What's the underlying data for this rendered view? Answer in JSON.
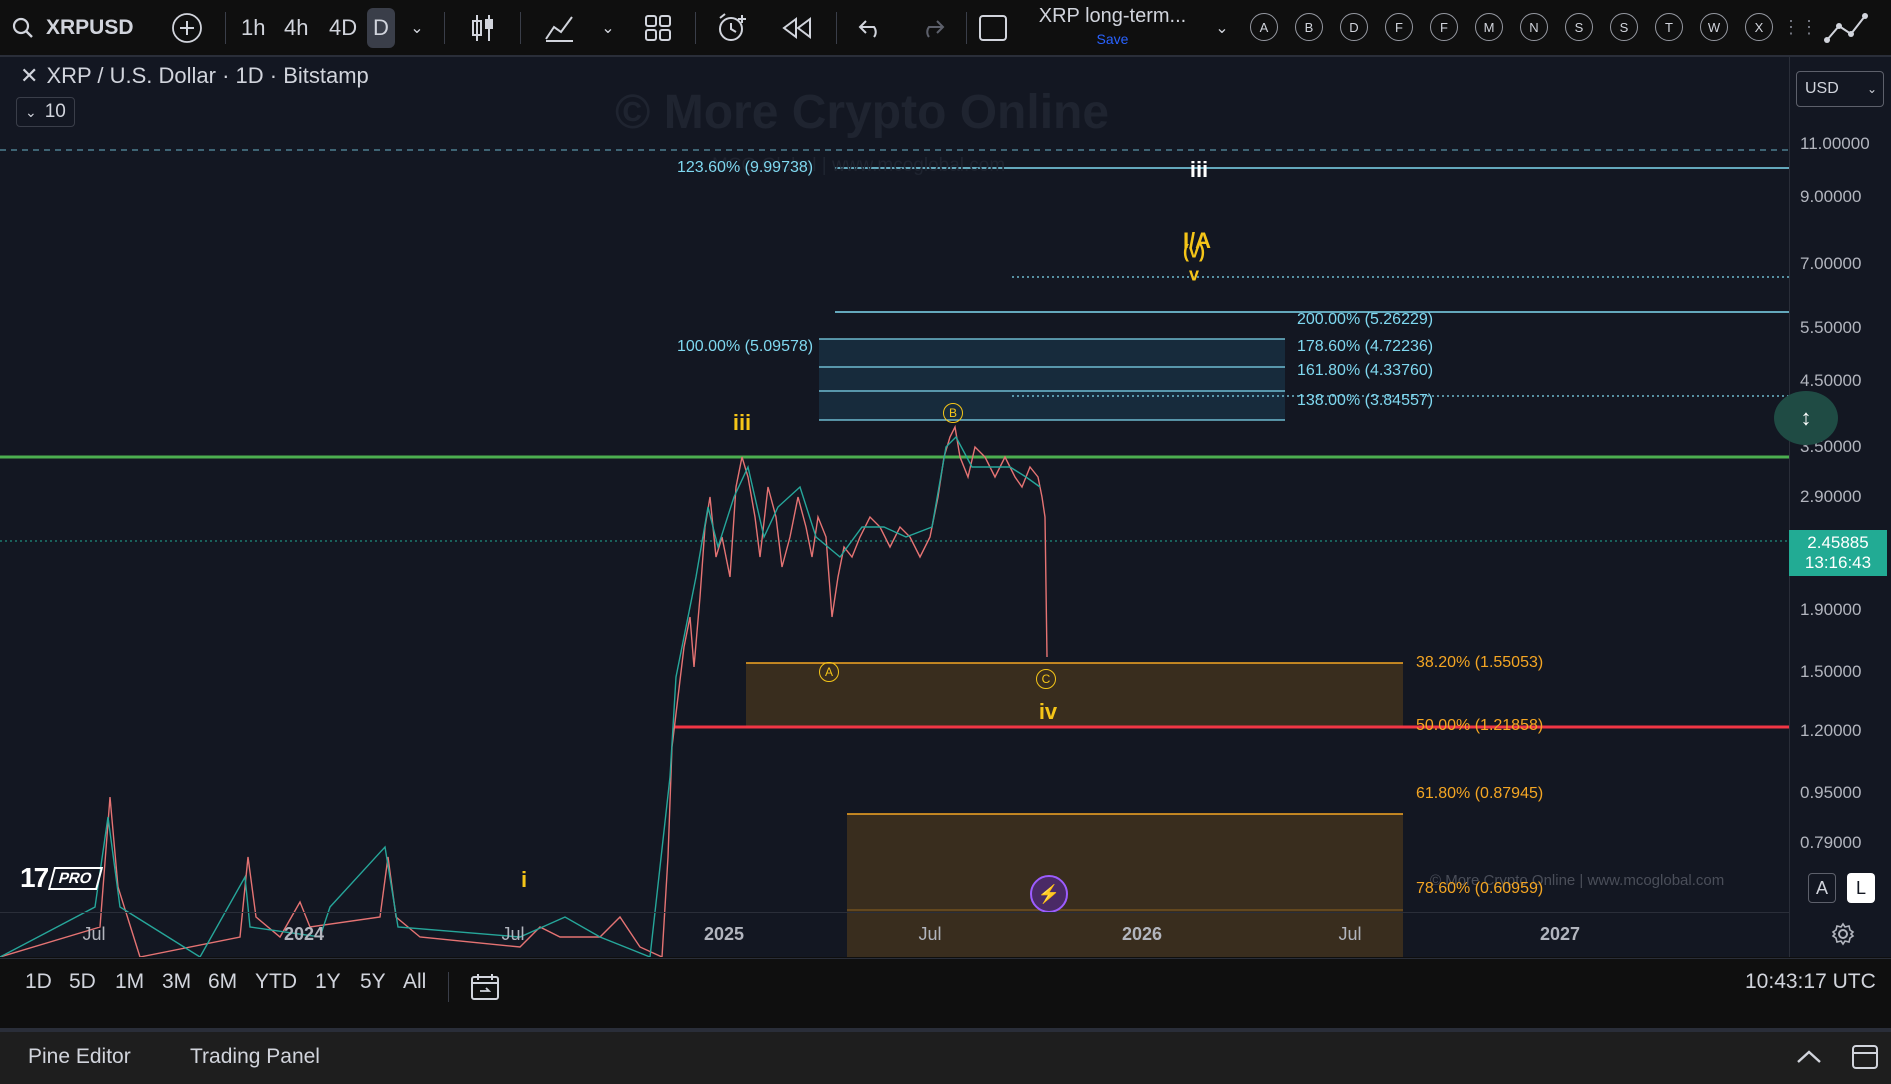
{
  "toolbar": {
    "symbol": "XRPUSD",
    "intervals": [
      "1h",
      "4h",
      "4D",
      "D"
    ],
    "layout_name": "XRP long-term...",
    "save_label": "Save",
    "letter_buttons": [
      "A",
      "B",
      "D",
      "F",
      "F",
      "M",
      "N",
      "S",
      "S",
      "T",
      "W",
      "X"
    ]
  },
  "legend": {
    "title": "XRP / U.S. Dollar · 1D · Bitstamp",
    "indicator_count": "10"
  },
  "watermark": {
    "title": "© More Crypto Online",
    "subtitle": "MCO Global  |  www.mcoglobal.com",
    "bottom": "© More Crypto Online  |  www.mcoglobal.com"
  },
  "currency": "USD",
  "price_scale": {
    "labels": [
      "11.00000",
      "9.00000",
      "7.00000",
      "5.50000",
      "4.50000",
      "3.50000",
      "2.90000",
      "1.90000",
      "1.50000",
      "1.20000",
      "0.95000",
      "0.79000"
    ],
    "current_price": "2.45885",
    "countdown": "13:16:43",
    "scale_mode": [
      "A",
      "L"
    ]
  },
  "time_axis": [
    "Jul",
    "2024",
    "Jul",
    "2025",
    "Jul",
    "2026",
    "Jul",
    "2027"
  ],
  "fib_levels_blue": [
    {
      "label": "123.60% (9.99738)"
    },
    {
      "label": "100.00% (5.09578)"
    },
    {
      "label": "200.00% (5.26229)"
    },
    {
      "label": "178.60% (4.72236)"
    },
    {
      "label": "161.80% (4.33760)"
    },
    {
      "label": "138.00% (3.84557)"
    }
  ],
  "fib_levels_orange": [
    {
      "label": "38.20% (1.55053)"
    },
    {
      "label": "50.00% (1.21858)"
    },
    {
      "label": "61.80% (0.87945)"
    },
    {
      "label": "78.60% (0.60959)"
    }
  ],
  "waves": {
    "iii_top": "iii",
    "iii_gold": "iii",
    "i_gold": "i",
    "iv": "iv",
    "iva": "I/A",
    "v_paren": "(v)",
    "v": "v",
    "A": "A",
    "B": "B",
    "C": "C"
  },
  "logo_badge": "PRO",
  "date_ranges": [
    "1D",
    "5D",
    "1M",
    "3M",
    "6M",
    "YTD",
    "1Y",
    "5Y",
    "All"
  ],
  "clock": "10:43:17 UTC",
  "footer": {
    "pine_editor": "Pine Editor",
    "trading_panel": "Trading Panel"
  },
  "colors": {
    "background": "#131722",
    "fib_blue": "#7fd8f0",
    "fib_orange": "#f5a623",
    "wave_gold": "#f5c518",
    "resistance_green": "#4caf50",
    "support_red": "#f23645",
    "current_price_bg": "#22ab94"
  }
}
